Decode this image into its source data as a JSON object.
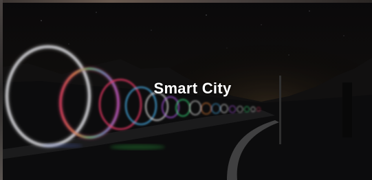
{
  "card": {
    "title": "Smart City",
    "image_icon": "light-trail-landscape-image",
    "accent_colors": [
      "#e8e8f0",
      "#ff3050",
      "#4fc0ff",
      "#c060ff",
      "#40ff90"
    ]
  }
}
